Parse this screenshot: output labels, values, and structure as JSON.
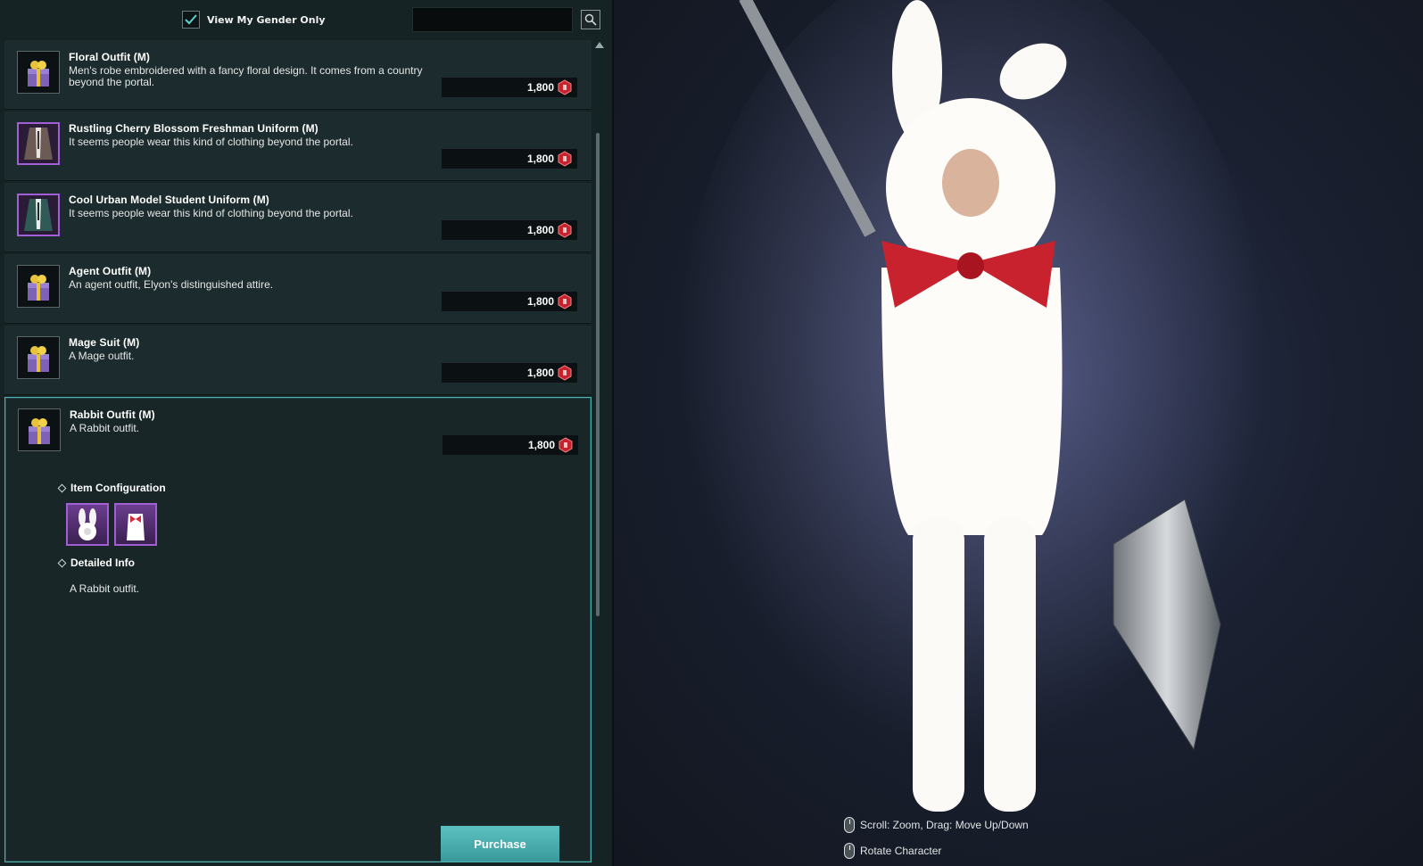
{
  "filter": {
    "gender_label": "View My Gender Only",
    "gender_checked": true
  },
  "search": {
    "value": "",
    "placeholder": ""
  },
  "items": [
    {
      "name": "Floral Outfit (M)",
      "description": "Men's robe embroidered with a fancy floral design. It comes from a country beyond the portal.",
      "price": "1,800",
      "icon": "gift-box-icon"
    },
    {
      "name": "Rustling Cherry Blossom Freshman Uniform (M)",
      "description": "It seems people wear this kind of clothing beyond the portal.",
      "price": "1,800",
      "icon": "jacket-icon"
    },
    {
      "name": "Cool Urban Model Student Uniform (M)",
      "description": "It seems people wear this kind of clothing beyond the portal.",
      "price": "1,800",
      "icon": "jacket-icon"
    },
    {
      "name": "Agent Outfit (M)",
      "description": "An agent outfit, Elyon's distinguished attire.",
      "price": "1,800",
      "icon": "gift-box-icon"
    },
    {
      "name": "Mage Suit (M)",
      "description": "A Mage outfit.",
      "price": "1,800",
      "icon": "gift-box-icon"
    },
    {
      "name": "Rabbit Outfit (M)",
      "description": "A Rabbit outfit.",
      "price": "1,800",
      "icon": "gift-box-icon"
    }
  ],
  "selected": {
    "item_config_label": "Item Configuration",
    "config_icons": [
      "rabbit-hood-icon",
      "rabbit-suit-icon"
    ],
    "detailed_info_label": "Detailed Info",
    "detailed_info_text": "A Rabbit outfit.",
    "purchase_label": "Purchase"
  },
  "hints": {
    "zoom": "Scroll: Zoom, Drag: Move Up/Down",
    "rotate": "Rotate Character"
  },
  "colors": {
    "accent": "#4fb3b4",
    "rarity_purple": "#a25fd5",
    "currency_red": "#c8222e"
  }
}
